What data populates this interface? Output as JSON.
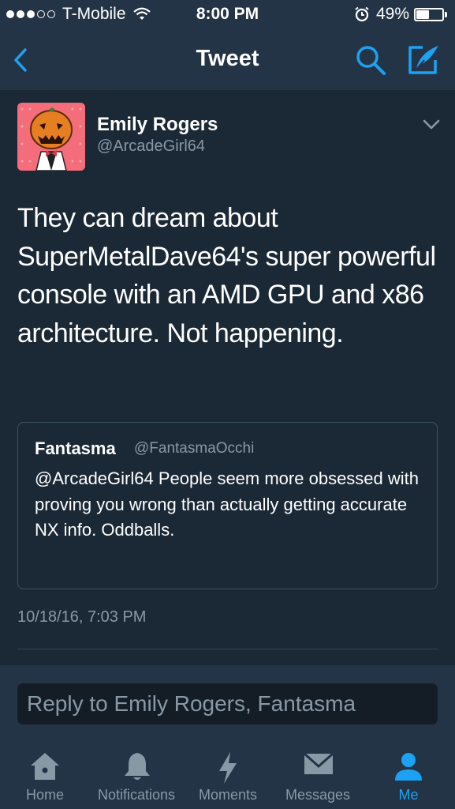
{
  "status_bar": {
    "carrier": "T-Mobile",
    "time": "8:00 PM",
    "battery": "49%",
    "battery_level": 0.49,
    "signal_bars": 3,
    "signal_total": 5
  },
  "nav": {
    "title": "Tweet",
    "back_icon": "back-chevron-icon",
    "search_icon": "search-icon",
    "compose_icon": "compose-tweet-icon"
  },
  "tweet": {
    "author_name": "Emily Rogers",
    "author_handle": "@ArcadeGirl64",
    "avatar_icon": "pumpkin-head-avatar",
    "text": "They can dream about SuperMetalDave64's super powerful console with an AMD GPU and x86 architecture. Not happening.",
    "timestamp": "10/18/16, 7:03 PM"
  },
  "quoted_tweet": {
    "author_name": "Fantasma",
    "author_handle": "@FantasmaOcchi",
    "text": "@ArcadeGirl64 People seem more obsessed with proving you wrong than actually getting accurate NX info. Oddballs."
  },
  "reply": {
    "placeholder": "Reply to Emily Rogers, Fantasma"
  },
  "tabs": [
    {
      "label": "Home",
      "icon": "home-icon",
      "active": false
    },
    {
      "label": "Notifications",
      "icon": "bell-icon",
      "active": false
    },
    {
      "label": "Moments",
      "icon": "lightning-icon",
      "active": false
    },
    {
      "label": "Messages",
      "icon": "envelope-icon",
      "active": false
    },
    {
      "label": "Me",
      "icon": "person-icon",
      "active": true
    }
  ],
  "colors": {
    "background": "#1b2836",
    "bar": "#243447",
    "accent": "#1da1f2",
    "secondary_text": "#8899a6"
  }
}
